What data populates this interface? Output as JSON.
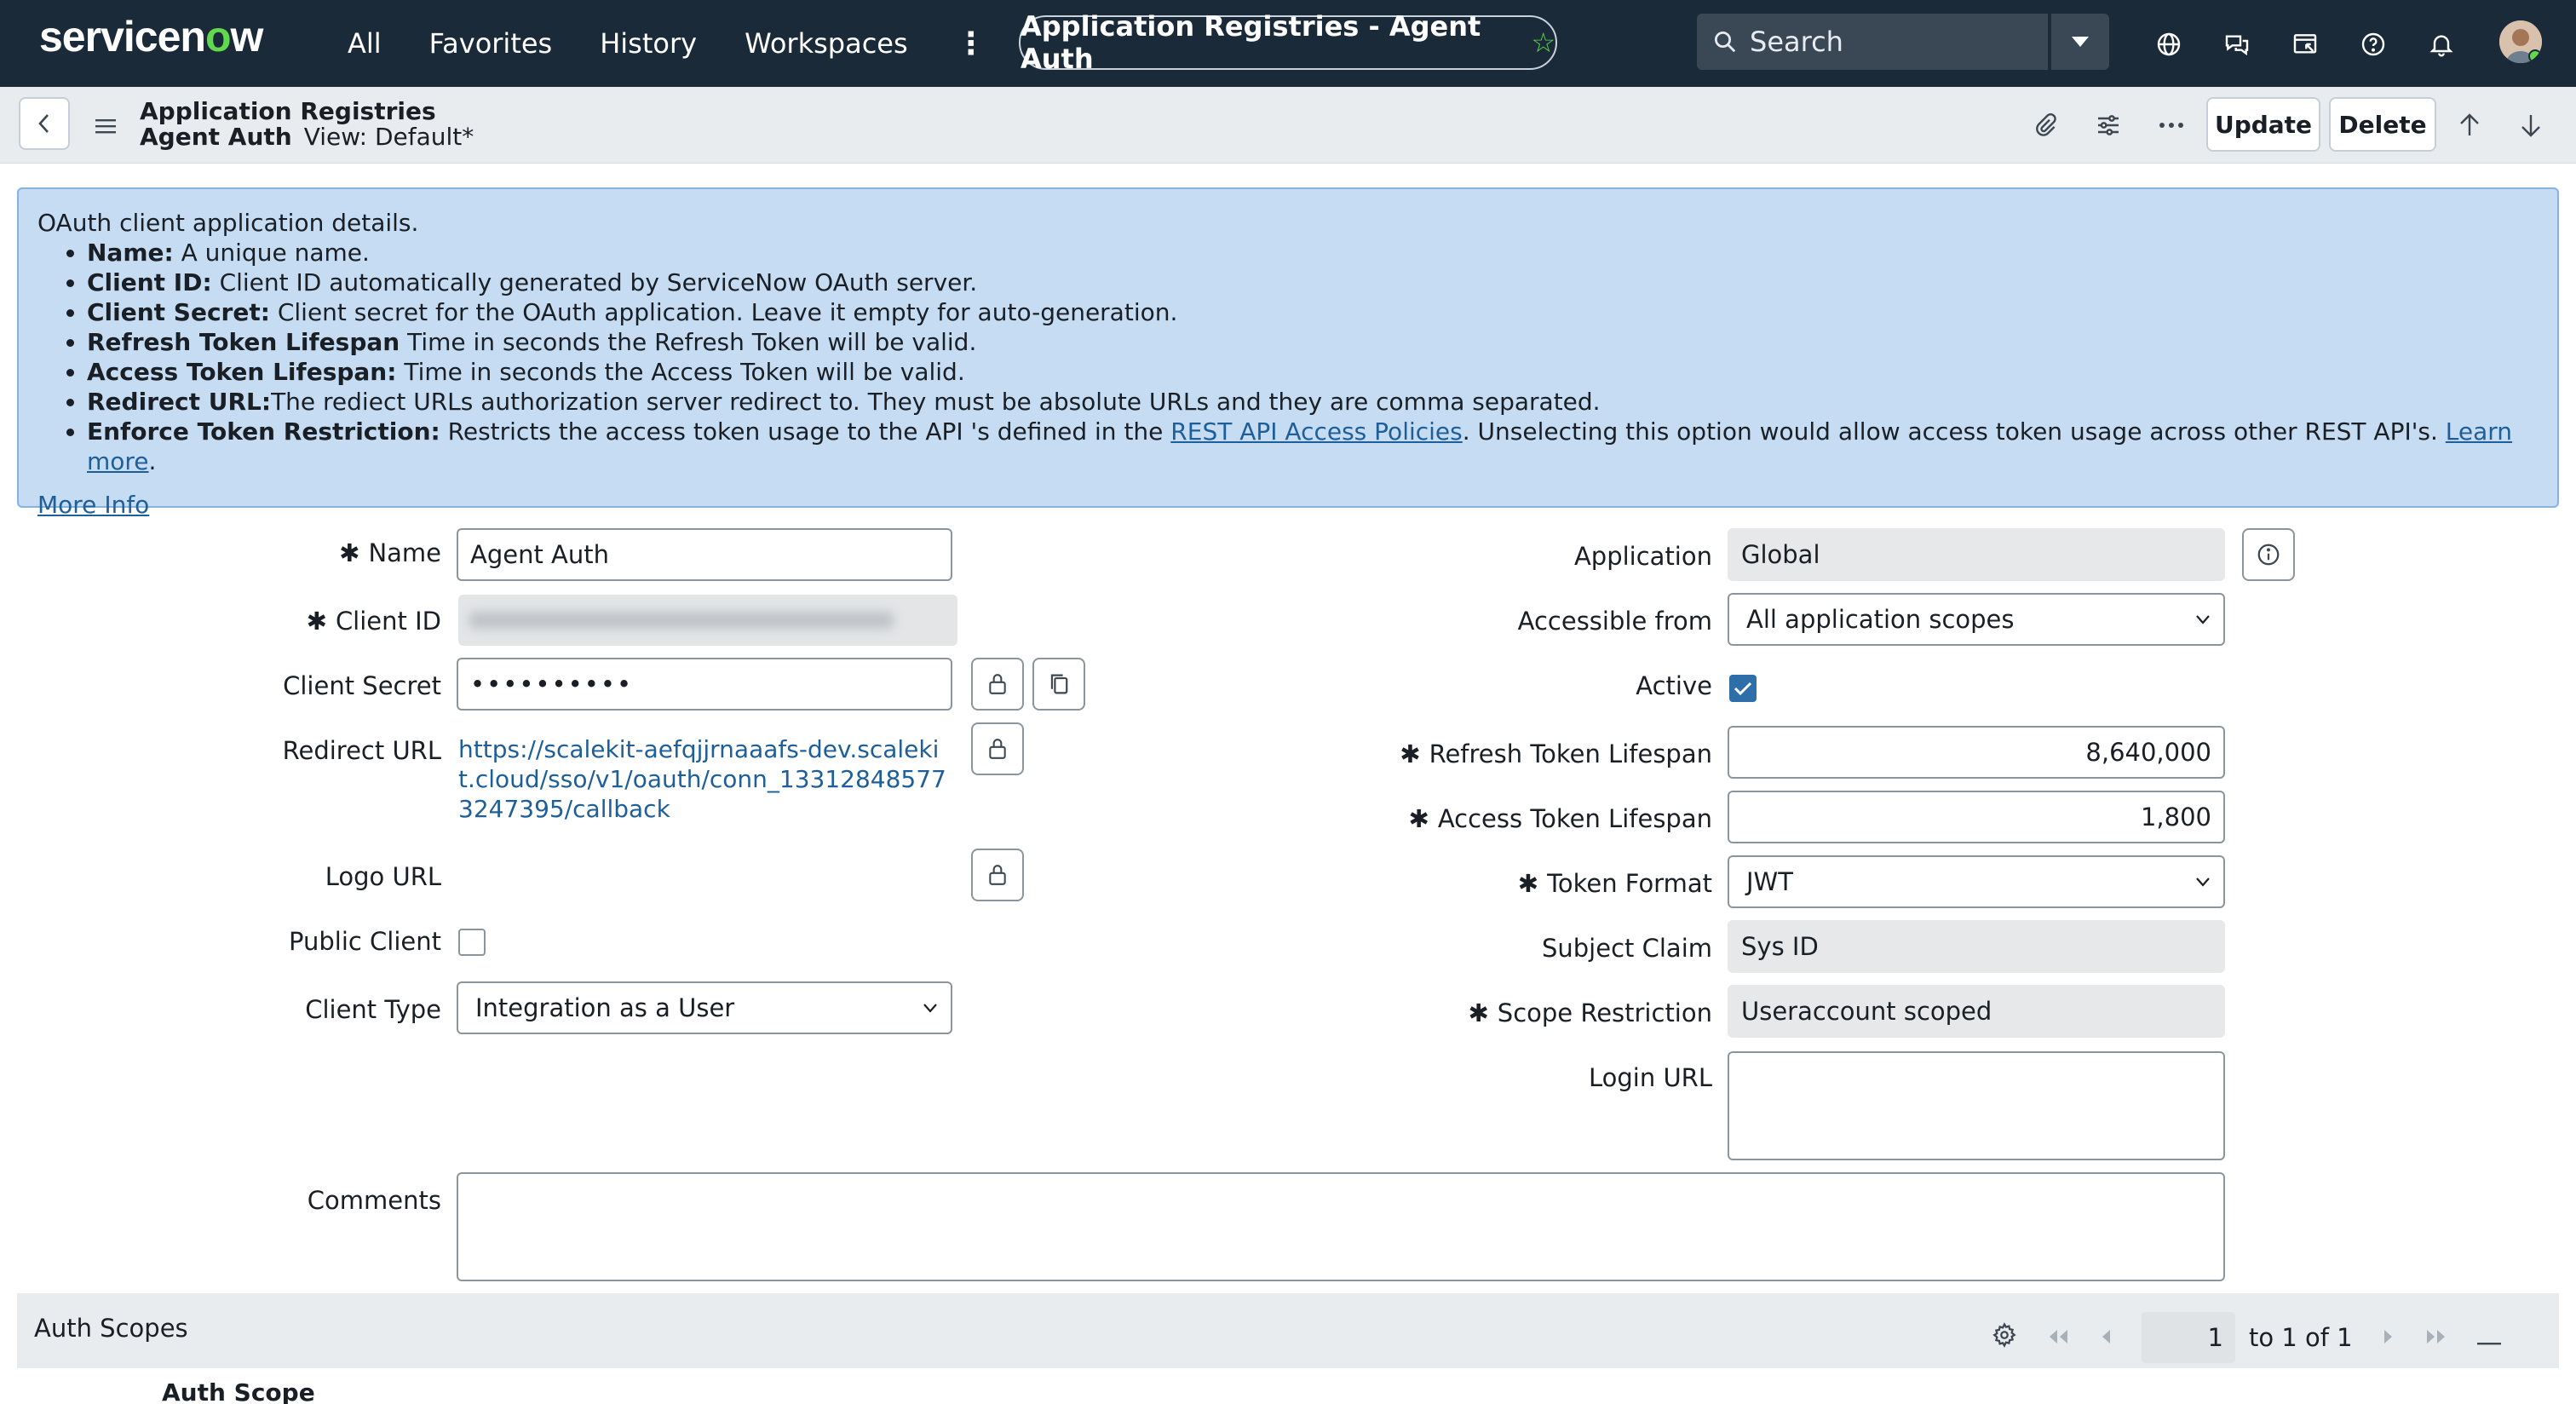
{
  "nav": {
    "logo_prefix": "servicen",
    "logo_o": "o",
    "logo_suffix": "w",
    "links": [
      "All",
      "Favorites",
      "History",
      "Workspaces"
    ],
    "title": "Application Registries - Agent Auth",
    "search_placeholder": "Search"
  },
  "header": {
    "breadcrumb_table": "Application Registries",
    "record_name": "Agent Auth",
    "view": "View: Default*",
    "update_label": "Update",
    "delete_label": "Delete"
  },
  "banner": {
    "intro": "OAuth client application details.",
    "items": [
      {
        "term": "Name:",
        "desc": " A unique name."
      },
      {
        "term": "Client ID:",
        "desc": " Client ID automatically generated by ServiceNow OAuth server."
      },
      {
        "term": "Client Secret:",
        "desc": " Client secret for the OAuth application. Leave it empty for auto-generation."
      },
      {
        "term": "Refresh Token Lifespan",
        "desc": " Time in seconds the Refresh Token will be valid."
      },
      {
        "term": "Access Token Lifespan:",
        "desc": " Time in seconds the Access Token will be valid."
      },
      {
        "term": "Redirect URL:",
        "desc": "The rediect URLs authorization server redirect to. They must be absolute URLs and they are comma separated."
      }
    ],
    "enforce_term": "Enforce Token Restriction:",
    "enforce_desc1": " Restricts the access token usage to the API 's defined in the ",
    "enforce_link1": "REST API Access Policies",
    "enforce_desc2": ". Unselecting this option would allow access token usage across other REST API's. ",
    "enforce_link2": "Learn more",
    "enforce_end": ".",
    "more_info": "More Info"
  },
  "form": {
    "left": {
      "name_label": "Name",
      "name_value": "Agent Auth",
      "client_id_label": "Client ID",
      "client_secret_label": "Client Secret",
      "client_secret_value": "••••••••••",
      "redirect_label": "Redirect URL",
      "redirect_value": "https://scalekit-aefqjjrnaaafs-dev.scalekit.cloud/sso/v1/oauth/conn_133128485773247395/callback",
      "logo_label": "Logo URL",
      "public_client_label": "Public Client",
      "client_type_label": "Client Type",
      "client_type_value": "Integration as a User",
      "comments_label": "Comments"
    },
    "right": {
      "application_label": "Application",
      "application_value": "Global",
      "accessible_label": "Accessible from",
      "accessible_value": "All application scopes",
      "active_label": "Active",
      "refresh_label": "Refresh Token Lifespan",
      "refresh_value": "8,640,000",
      "access_label": "Access Token Lifespan",
      "access_value": "1,800",
      "token_format_label": "Token Format",
      "token_format_value": "JWT",
      "subject_label": "Subject Claim",
      "subject_value": "Sys ID",
      "scope_label": "Scope Restriction",
      "scope_value": "Useraccount scoped",
      "login_label": "Login URL"
    },
    "required_mark": "✱"
  },
  "related": {
    "title": "Auth Scopes",
    "page": "1",
    "range": "to 1 of 1",
    "column": "Auth Scope"
  }
}
